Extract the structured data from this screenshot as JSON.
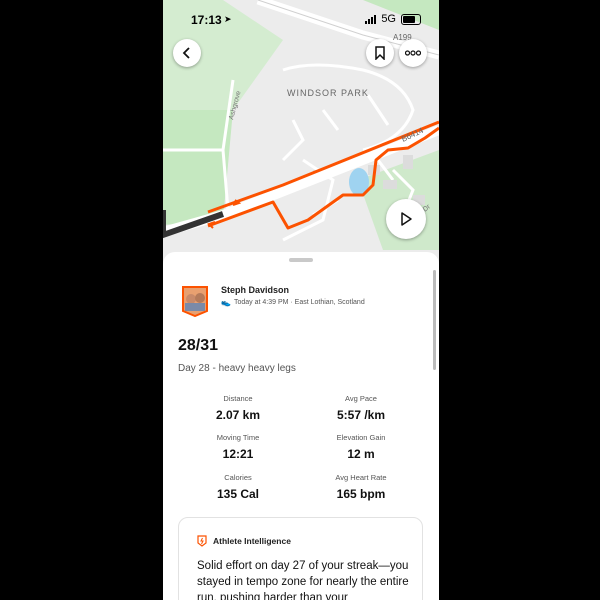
{
  "status_bar": {
    "time": "17:13",
    "network": "5G"
  },
  "map": {
    "park_label": "WINDSOR PARK",
    "road_label_1": "A199",
    "road_label_2": "B6414",
    "street_label": "Ashgrove",
    "dr_label": "Dr"
  },
  "activity": {
    "athlete_name": "Steph  Davidson",
    "meta": "Today at 4:39 PM · East Lothian, Scotland",
    "title": "28/31",
    "description": "Day 28 - heavy heavy legs",
    "stats": [
      {
        "label": "Distance",
        "value": "2.07 km"
      },
      {
        "label": "Avg Pace",
        "value": "5:57 /km"
      },
      {
        "label": "Moving Time",
        "value": "12:21"
      },
      {
        "label": "Elevation Gain",
        "value": "12 m"
      },
      {
        "label": "Calories",
        "value": "135 Cal"
      },
      {
        "label": "Avg Heart Rate",
        "value": "165 bpm"
      }
    ]
  },
  "athlete_intelligence": {
    "heading": "Athlete Intelligence",
    "text": "Solid effort on day 27 of your streak—you stayed in tempo zone for nearly the entire run, pushing harder than your"
  },
  "colors": {
    "route": "#fc5200",
    "map_bg": "#ececec",
    "park_green": "#c5e8c0",
    "water": "#9fd3f0"
  }
}
